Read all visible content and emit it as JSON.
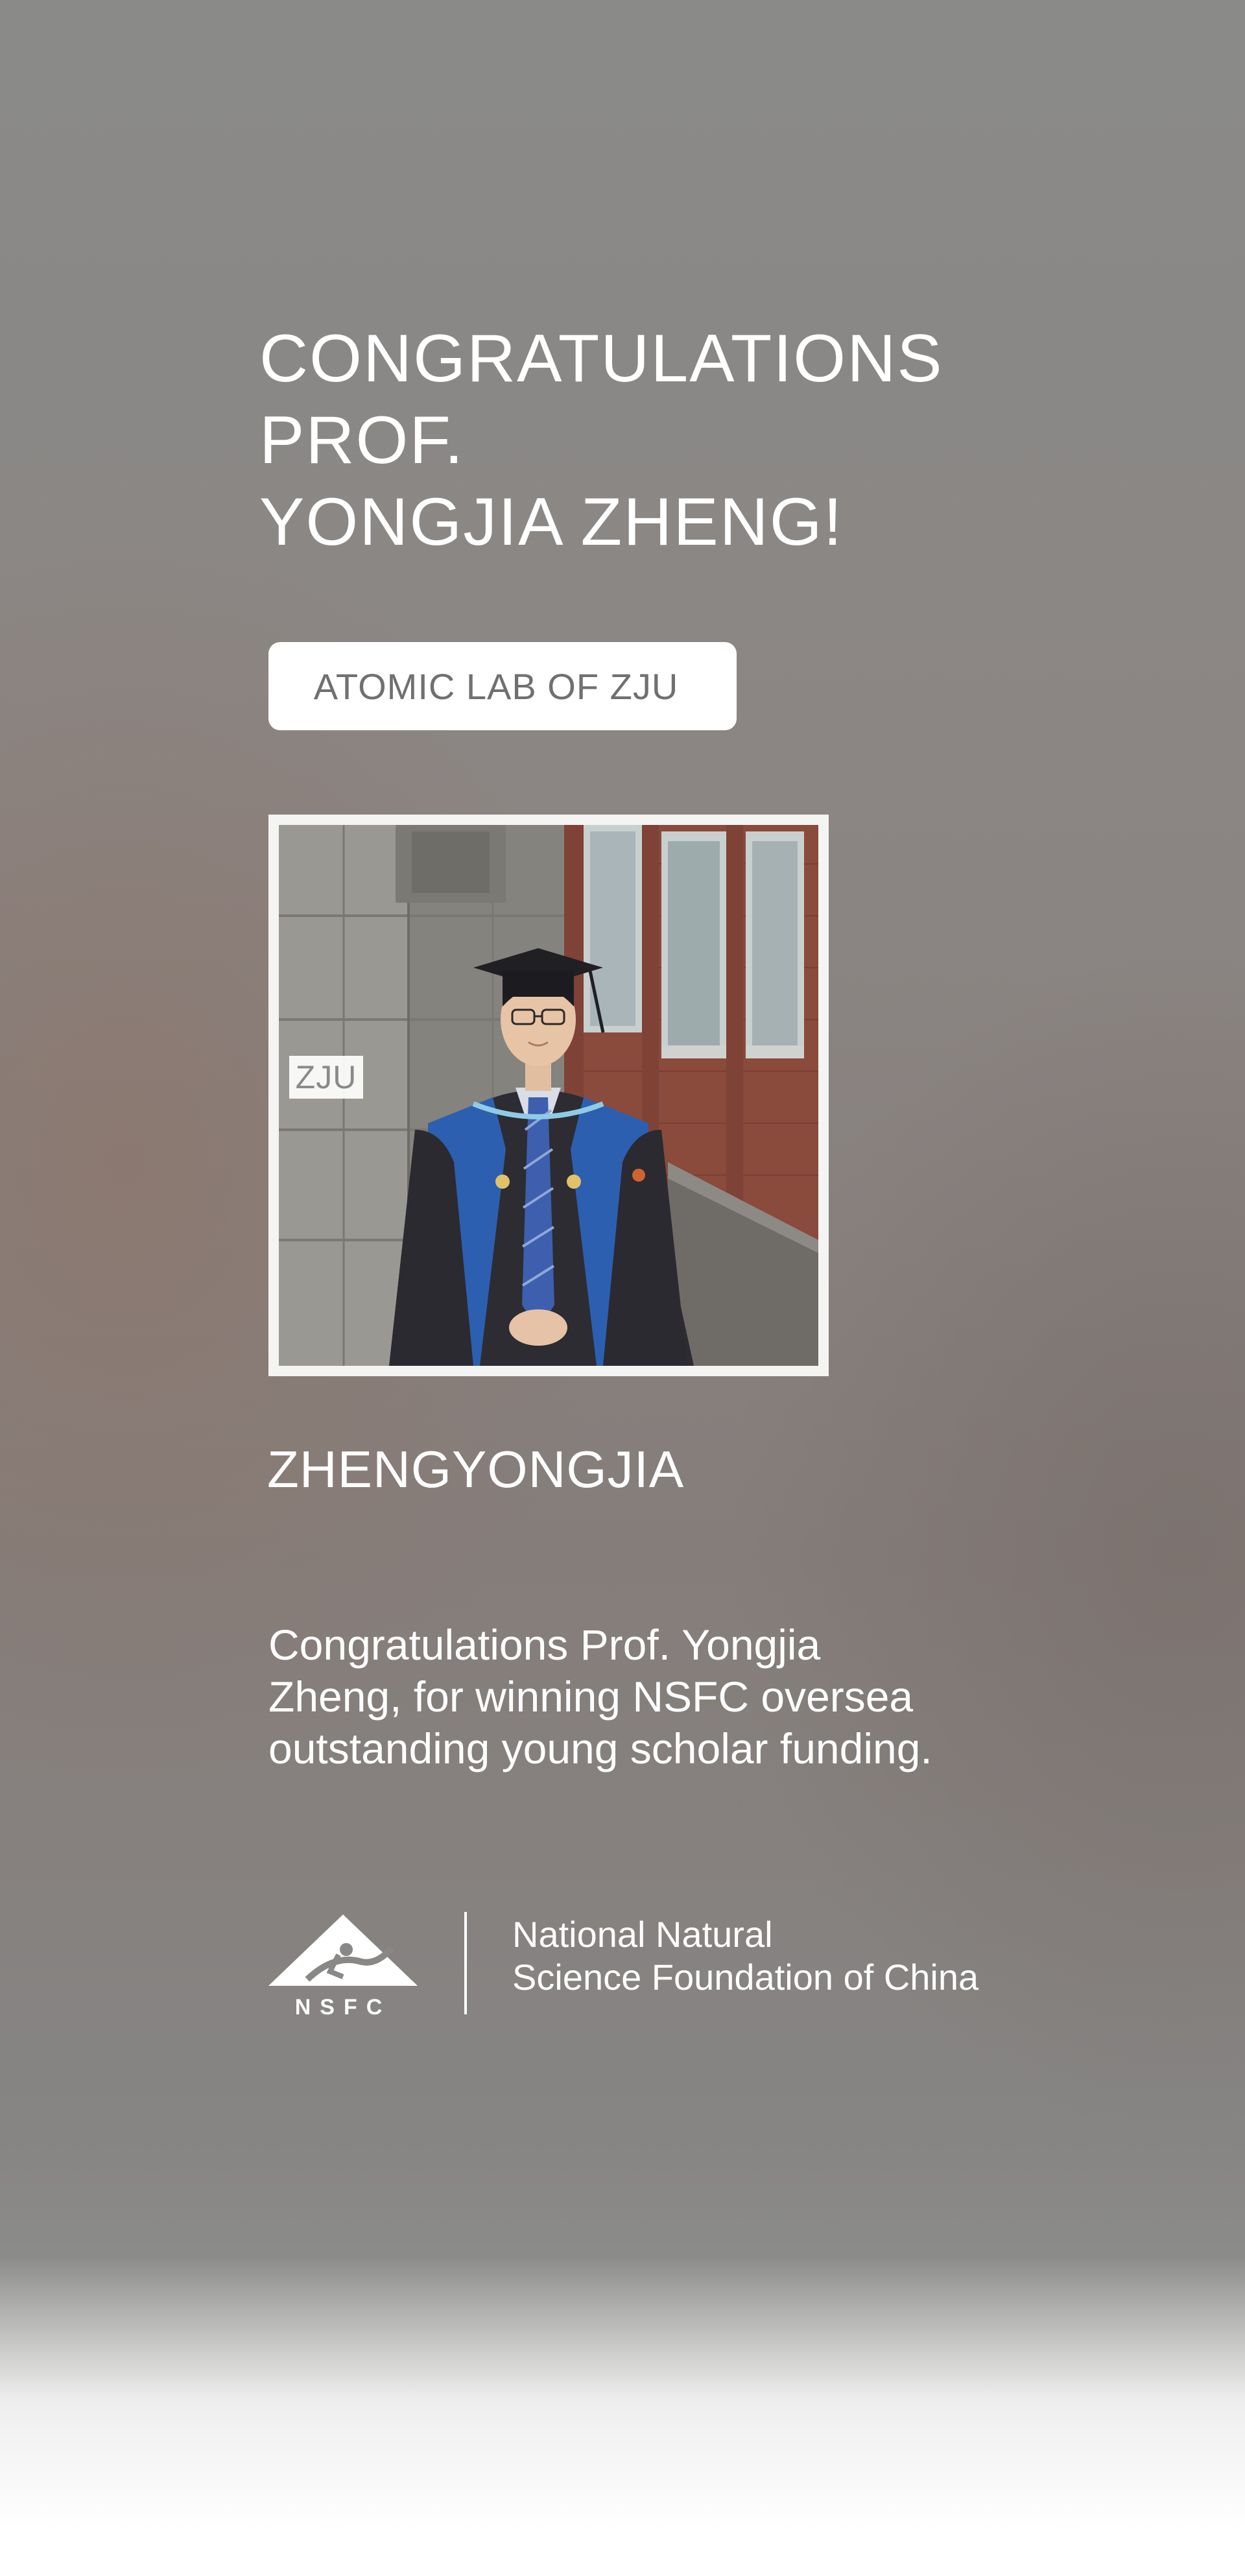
{
  "headline": {
    "line1": "CONGRATULATIONS",
    "line2": "PROF.",
    "line3": "YONGJIA ZHENG!"
  },
  "lab_badge": "ATOMIC LAB OF ZJU",
  "photo": {
    "tag": "ZJU"
  },
  "person_name": "ZHENGYONGJIA",
  "announcement": {
    "line1": "Congratulations Prof. Yongjia",
    "line2": "Zheng, for winning NSFC oversea",
    "line3": "outstanding young scholar funding."
  },
  "organization": {
    "logo_text": "NSFC",
    "name_line1": "National Natural",
    "name_line2": "Science Foundation of China"
  },
  "colors": {
    "text": "#ffffff",
    "badge_background": "#ffffff",
    "badge_text": "#707070"
  },
  "icons": {
    "nsfc_logo": "nsfc-logo-icon"
  }
}
